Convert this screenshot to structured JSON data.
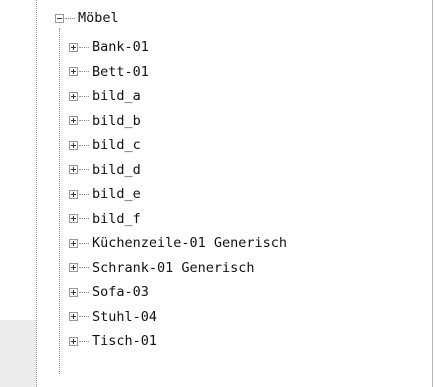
{
  "tree": {
    "root": {
      "label": "Möbel",
      "expanded": true,
      "expander_icon": "minus-box-icon"
    },
    "children": [
      {
        "label": "Bank-01"
      },
      {
        "label": "Bett-01"
      },
      {
        "label": "bild_a"
      },
      {
        "label": "bild_b"
      },
      {
        "label": "bild_c"
      },
      {
        "label": "bild_d"
      },
      {
        "label": "bild_e"
      },
      {
        "label": "bild_f"
      },
      {
        "label": "Küchenzeile-01 Generisch"
      },
      {
        "label": "Schrank-01 Generisch"
      },
      {
        "label": "Sofa-03"
      },
      {
        "label": "Stuhl-04"
      },
      {
        "label": "Tisch-01"
      }
    ],
    "child_expander_icon": "plus-box-icon"
  },
  "colors": {
    "text": "#111111",
    "connector": "#8a8a8a",
    "expander_border": "#9a9a9a",
    "gutter": "#ececec",
    "pane_border": "#b5b5b5"
  }
}
